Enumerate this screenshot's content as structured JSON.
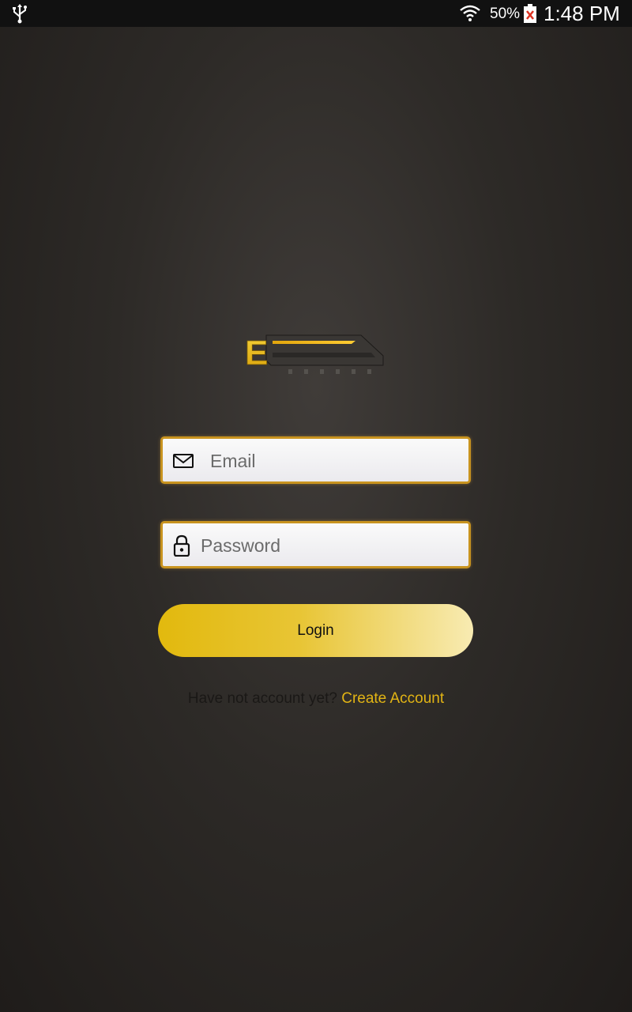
{
  "status_bar": {
    "battery_percent": "50%",
    "time": "1:48 PM",
    "icons": [
      "usb-icon",
      "wifi-icon",
      "battery-icon"
    ]
  },
  "logo": {
    "letter": "E"
  },
  "login_form": {
    "email": {
      "placeholder": "Email",
      "value": "",
      "icon": "mail-icon"
    },
    "password": {
      "placeholder": "Password",
      "value": "",
      "icon": "lock-icon"
    },
    "login_label": "Login",
    "signup_prompt": "Have not account yet?",
    "signup_link": "Create Account"
  },
  "colors": {
    "accent": "#e2b414",
    "field_border": "#c8931f",
    "background": "#2d2a27"
  }
}
